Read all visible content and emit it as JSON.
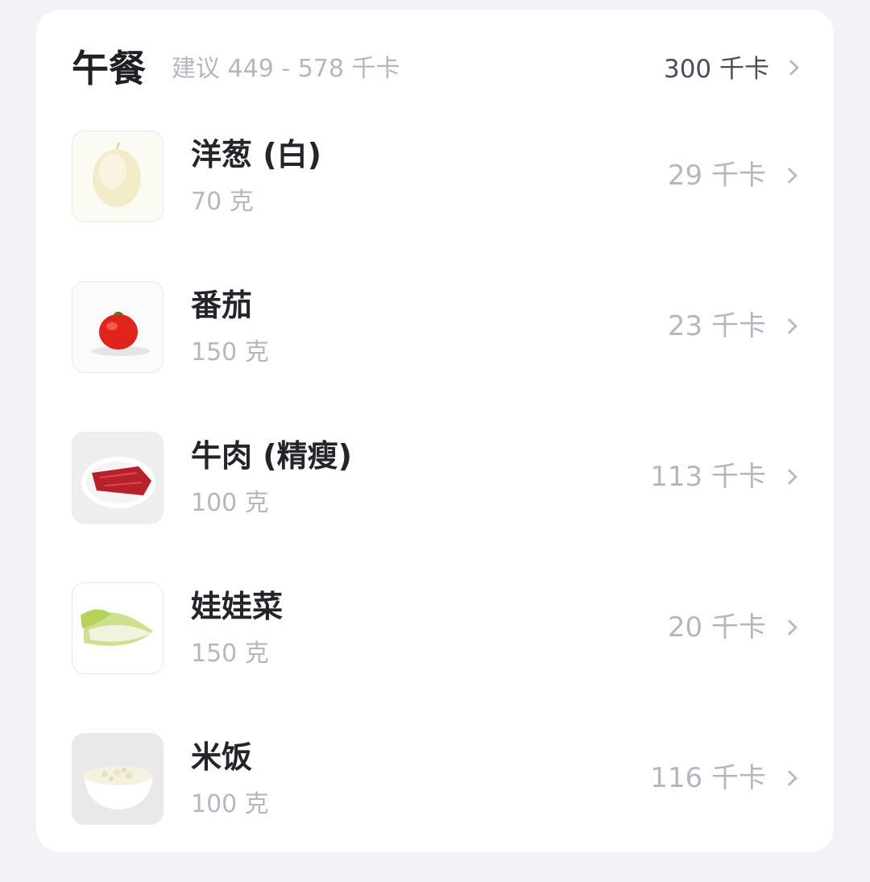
{
  "meal": {
    "title": "午餐",
    "suggestion": "建议 449 - 578 千卡",
    "total": "300 千卡"
  },
  "foods": [
    {
      "name": "洋葱 (白)",
      "quantity": "70 克",
      "calories": "29 千卡",
      "icon": "onion-icon"
    },
    {
      "name": "番茄",
      "quantity": "150 克",
      "calories": "23 千卡",
      "icon": "tomato-icon"
    },
    {
      "name": "牛肉 (精瘦)",
      "quantity": "100 克",
      "calories": "113 千卡",
      "icon": "beef-icon"
    },
    {
      "name": "娃娃菜",
      "quantity": "150 克",
      "calories": "20 千卡",
      "icon": "baby-cabbage-icon"
    },
    {
      "name": "米饭",
      "quantity": "100 克",
      "calories": "116 千卡",
      "icon": "rice-icon"
    }
  ]
}
